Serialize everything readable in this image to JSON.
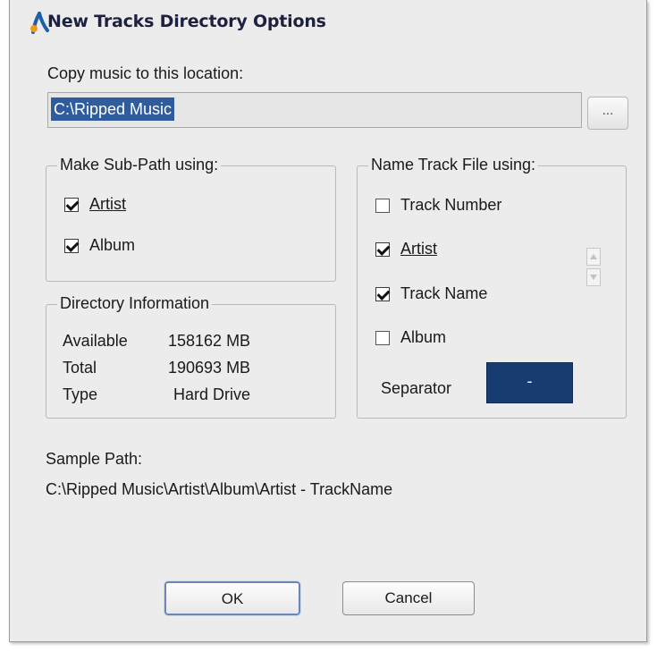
{
  "window": {
    "title": "New Tracks Directory Options"
  },
  "copy_location": {
    "label": "Copy music to this location:",
    "value": "C:\\Ripped Music",
    "browse_label": "..."
  },
  "sub_path": {
    "legend": "Make Sub-Path using:",
    "options": [
      {
        "label": "Artist",
        "checked": true
      },
      {
        "label": "Album",
        "checked": true
      }
    ]
  },
  "directory_info": {
    "legend": "Directory Information",
    "rows": [
      {
        "name": "Available",
        "value": "158162 MB"
      },
      {
        "name": "Total",
        "value": "190693 MB"
      },
      {
        "name": "Type",
        "value": "Hard Drive"
      }
    ]
  },
  "name_track": {
    "legend": "Name Track File using:",
    "options": [
      {
        "label": "Track Number",
        "checked": false
      },
      {
        "label": "Artist",
        "checked": true
      },
      {
        "label": "Track Name",
        "checked": true
      },
      {
        "label": "Album",
        "checked": false
      }
    ],
    "separator_label": "Separator",
    "separator_value": "-"
  },
  "sample_path": {
    "label": "Sample Path:",
    "value": "C:\\Ripped Music\\Artist\\Album\\Artist - TrackName"
  },
  "buttons": {
    "ok": "OK",
    "cancel": "Cancel"
  },
  "colors": {
    "selection": "#2f5c9c",
    "separator_bg": "#173d70",
    "dialog_bg": "#ececec"
  }
}
